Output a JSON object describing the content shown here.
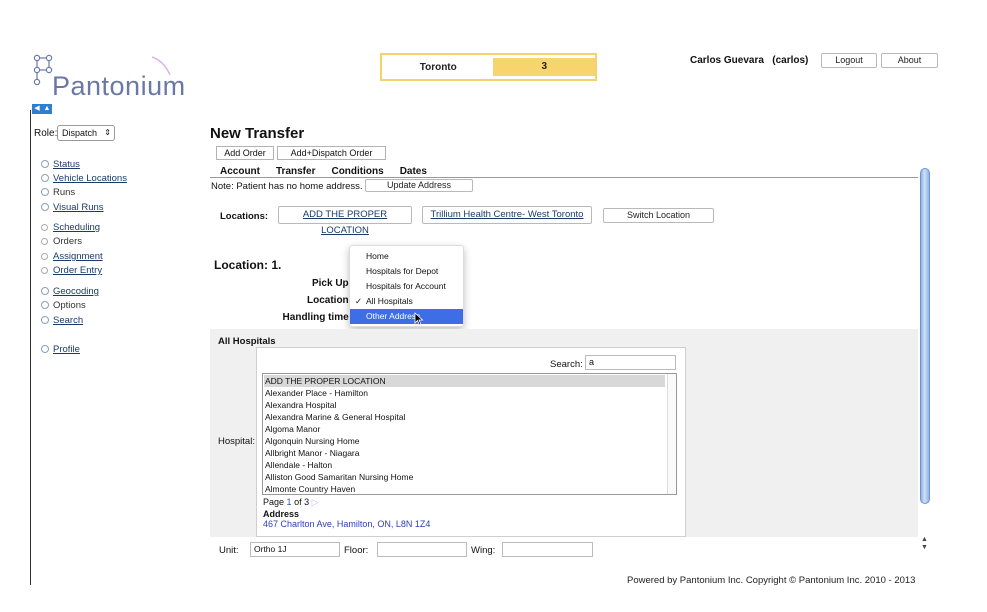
{
  "app": {
    "logo_text": "Pantonium"
  },
  "header": {
    "city": "Toronto",
    "city_count": "3",
    "user": "Carlos Guevara   (carlos)",
    "logout_label": "Logout",
    "about_label": "About"
  },
  "sidebar": {
    "role_label": "Role:",
    "role_value": "Dispatch",
    "items": [
      {
        "label": "Status"
      },
      {
        "label": "Vehicle Locations"
      },
      {
        "label": "Runs"
      },
      {
        "label": "Visual Runs"
      },
      {
        "label": "Scheduling"
      },
      {
        "label": "Orders"
      },
      {
        "label": "Assignment"
      },
      {
        "label": "Order Entry"
      },
      {
        "label": "Geocoding"
      },
      {
        "label": "Options"
      },
      {
        "label": "Search"
      },
      {
        "label": "Profile"
      }
    ]
  },
  "main": {
    "title": "New Transfer",
    "tabs": [
      "Add Order",
      "Add+Dispatch Order"
    ],
    "subtabs": [
      "Account",
      "Transfer",
      "Conditions",
      "Dates"
    ],
    "note": "Note: Patient has no home address.",
    "update_address_label": "Update Address",
    "locations_label": "Locations:",
    "location_1": "ADD THE PROPER LOCATION",
    "location_2": "Trillium Health Centre- West Toronto",
    "switch_location_label": "Switch Location",
    "location_heading": "Location: 1.",
    "pickup_label": "Pick Up:",
    "location_label": "Location:",
    "handling_label": "Handling time:",
    "dropdown": {
      "items": [
        "Home",
        "Hospitals for Depot",
        "Hospitals for Account",
        "All Hospitals",
        "Other Address"
      ],
      "checked": "✓"
    },
    "hospitals": {
      "panel_title": "All Hospitals",
      "search_label": "Search:",
      "search_value": "a",
      "hospital_label": "Hospital:",
      "list": [
        "ADD THE PROPER LOCATION",
        "Alexander Place - Hamilton",
        "Alexandra Hospital",
        "Alexandra Marine & General Hospital",
        "Algoma Manor",
        "Algonquin Nursing Home",
        "Allbright Manor - Niagara",
        "Allendale - Halton",
        "Alliston Good Samaritan Nursing Home",
        "Almonte Country Haven"
      ],
      "page_prefix": "Page",
      "page_current": "1",
      "page_of": "of 3",
      "address_title": "Address",
      "address": "467 Charlton Ave, Hamilton, ON, L8N 1Z4"
    },
    "unit_label": "Unit:",
    "unit_value": "Ortho 1J",
    "floor_label": "Floor:",
    "wing_label": "Wing:"
  },
  "footer": {
    "text": "Powered by Pantonium Inc. Copyright © Pantonium Inc. 2010 - 2013"
  },
  "colors": {
    "accent": "#f7d46e",
    "link": "#1a3a6a",
    "highlight": "#3e6ee6"
  }
}
